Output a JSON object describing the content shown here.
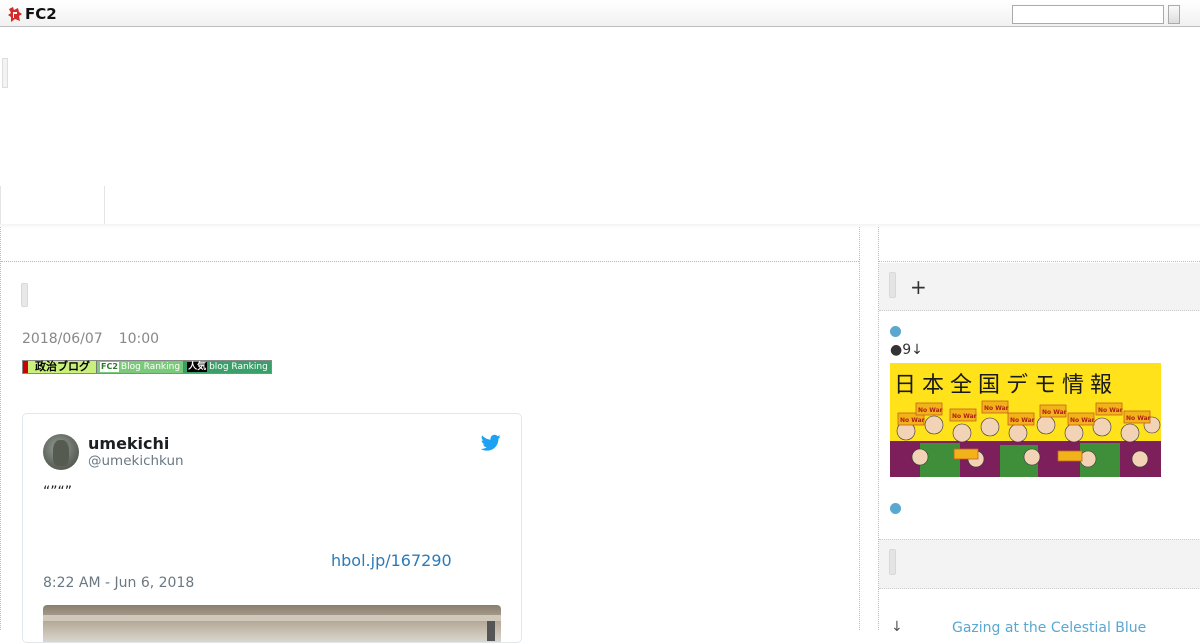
{
  "brand": {
    "logo_text": "FC2"
  },
  "search": {
    "placeholder": ""
  },
  "post": {
    "date": "2018/06/07",
    "time": "10:00",
    "rank_banner": {
      "seiji_label": "政治ブログ",
      "fc2_badge": "FC2",
      "fc2_label": "Blog Ranking",
      "ninki_badge": "人気",
      "ninki_label": "blog Ranking"
    }
  },
  "tweet": {
    "name": "umekichi",
    "handle": "@umekichkun",
    "text": "“”“”",
    "link": "hbol.jp/167290",
    "timestamp": "8:22 AM - Jun 6, 2018"
  },
  "sidebar": {
    "plus_label": "+",
    "line_text": "●9↓",
    "demo_banner_title": "日本全国デモ情報",
    "demo_banner_sign": "No War",
    "link_bullet": "↓",
    "link_text": "Gazing at the Celestial Blue"
  },
  "colors": {
    "accent": "#5aa7d0",
    "twitter_blue": "#1da1f2",
    "link_blue": "#2b7bb9",
    "banner_yellow": "#ffe21a"
  }
}
